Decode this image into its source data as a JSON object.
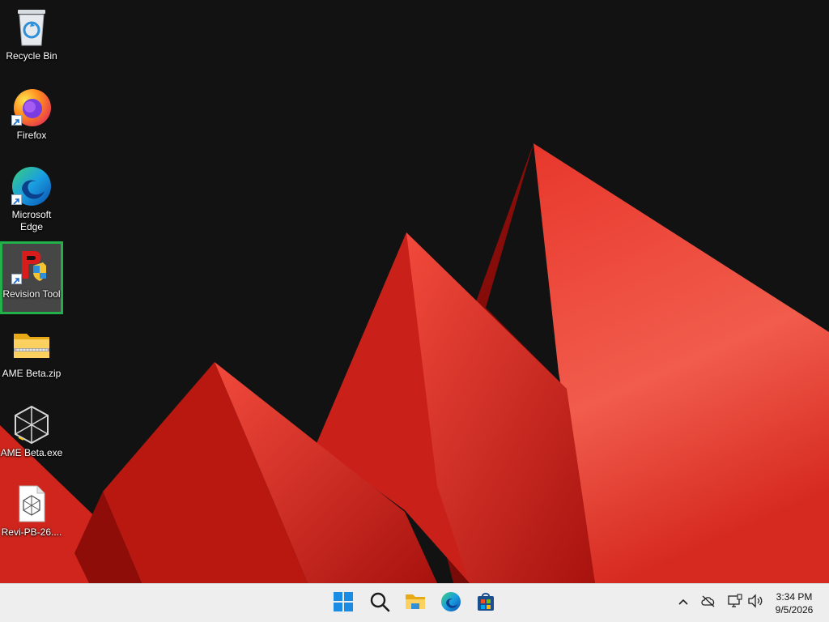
{
  "desktop": {
    "icons": [
      {
        "label": "Recycle Bin",
        "icon": "recycle-bin-icon",
        "selected": false
      },
      {
        "label": "Firefox",
        "icon": "firefox-icon",
        "selected": false
      },
      {
        "label": "Microsoft Edge",
        "icon": "edge-icon",
        "selected": false
      },
      {
        "label": "Revision Tool",
        "icon": "revision-tool-icon",
        "selected": true
      },
      {
        "label": "AME Beta.zip",
        "icon": "zip-folder-icon",
        "selected": false
      },
      {
        "label": "AME Beta.exe",
        "icon": "ame-cube-icon",
        "selected": false
      },
      {
        "label": "Revi-PB-26....",
        "icon": "document-cube-icon",
        "selected": false
      }
    ],
    "accent_selection": "#22b04a",
    "wallpaper_colors": [
      "#121212",
      "#e8332a",
      "#b3140f",
      "#f46050"
    ]
  },
  "taskbar": {
    "apps": [
      {
        "name": "Start",
        "icon": "windows-start-icon"
      },
      {
        "name": "Search",
        "icon": "search-icon"
      },
      {
        "name": "File Explorer",
        "icon": "file-explorer-icon"
      },
      {
        "name": "Microsoft Edge",
        "icon": "edge-icon"
      },
      {
        "name": "Microsoft Store",
        "icon": "store-icon"
      }
    ],
    "tray": {
      "icons": [
        "chevron-up-icon",
        "cloud-offline-icon",
        "network-icon",
        "volume-icon"
      ]
    },
    "clock": {
      "time": "3:34 PM",
      "date": "9/5/2026"
    }
  }
}
